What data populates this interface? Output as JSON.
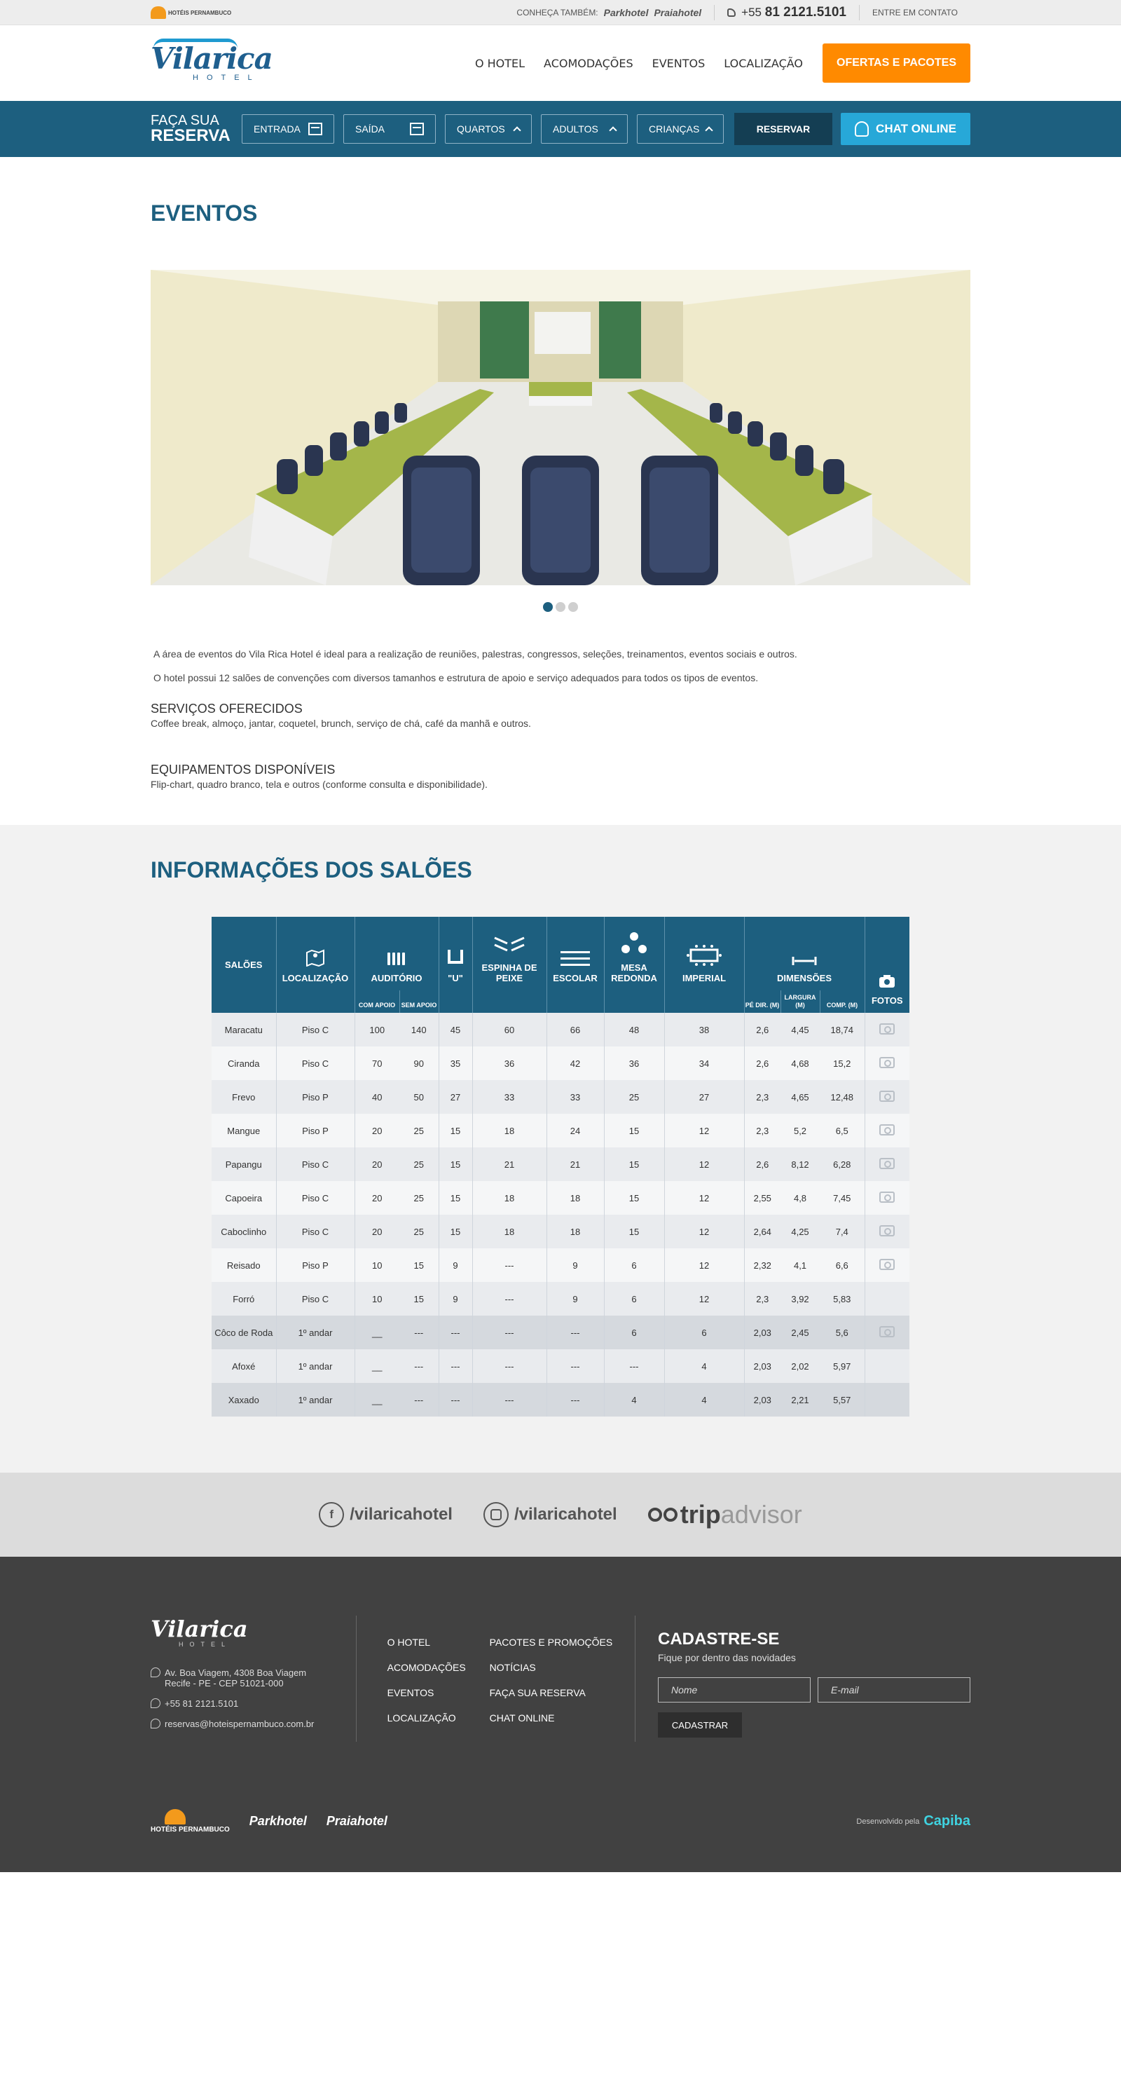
{
  "topbar": {
    "logo_label": "HOTÉIS PERNAMBUCO",
    "conheca": "CONHEÇA TAMBÉM:",
    "brand1": "Parkhotel",
    "brand2": "Praiahotel",
    "phone_prefix": "+55",
    "phone_number": "81 2121.5101",
    "contact": "ENTRE EM CONTATO"
  },
  "header": {
    "logo_main": "Vilarica",
    "logo_sub": "HOTEL",
    "nav": [
      "O HOTEL",
      "ACOMODAÇÕES",
      "EVENTOS",
      "LOCALIZAÇÃO"
    ],
    "cta": "OFERTAS E PACOTES"
  },
  "booking": {
    "title1": "FAÇA SUA",
    "title2": "RESERVA",
    "entrada": "ENTRADA",
    "saida": "SAÍDA",
    "quartos": "QUARTOS",
    "adultos": "ADULTOS",
    "criancas": "CRIANÇAS",
    "reservar": "RESERVAR",
    "chat": "CHAT ONLINE"
  },
  "eventos": {
    "title": "EVENTOS",
    "intro1": "A área de eventos do Vila Rica Hotel é ideal para a realização de reuniões, palestras, congressos, seleções, treinamentos, eventos sociais e outros.",
    "intro2": "O hotel possui 12 salões de convenções com diversos tamanhos e estrutura de apoio e serviço adequados para todos os tipos de eventos.",
    "servicos_h": "SERVIÇOS OFERECIDOS",
    "servicos_p": "Coffee break, almoço, jantar, coquetel, brunch, serviço de chá, café da manhã e outros.",
    "equip_h": "EQUIPAMENTOS DISPONÍVEIS",
    "equip_p": "Flip-chart, quadro branco, tela e outros (conforme consulta e disponibilidade)."
  },
  "saloes": {
    "title": "INFORMAÇÕES DOS SALÕES",
    "headers": {
      "saloes": "SALÕES",
      "localizacao": "LOCALIZAÇÃO",
      "auditorio": "AUDITÓRIO",
      "u": "\"U\"",
      "espinha": "ESPINHA DE PEIXE",
      "escolar": "ESCOLAR",
      "mesa": "MESA REDONDA",
      "imperial": "IMPERIAL",
      "dimensoes": "DIMENSÕES",
      "fotos": "FOTOS",
      "com_apoio": "COM APOIO",
      "sem_apoio": "SEM APOIO",
      "pe_dir": "PÉ DIR. (M)",
      "largura": "LARGURA (M)",
      "comp": "COMP. (M)"
    },
    "rows": [
      {
        "nome": "Maracatu",
        "loc": "Piso C",
        "com": "100",
        "sem": "140",
        "u": "45",
        "esp": "60",
        "esc": "66",
        "mesa": "48",
        "imp": "38",
        "pe": "2,6",
        "larg": "4,45",
        "comp": "18,74",
        "foto": true
      },
      {
        "nome": "Ciranda",
        "loc": "Piso C",
        "com": "70",
        "sem": "90",
        "u": "35",
        "esp": "36",
        "esc": "42",
        "mesa": "36",
        "imp": "34",
        "pe": "2,6",
        "larg": "4,68",
        "comp": "15,2",
        "foto": true
      },
      {
        "nome": "Frevo",
        "loc": "Piso P",
        "com": "40",
        "sem": "50",
        "u": "27",
        "esp": "33",
        "esc": "33",
        "mesa": "25",
        "imp": "27",
        "pe": "2,3",
        "larg": "4,65",
        "comp": "12,48",
        "foto": true
      },
      {
        "nome": "Mangue",
        "loc": "Piso P",
        "com": "20",
        "sem": "25",
        "u": "15",
        "esp": "18",
        "esc": "24",
        "mesa": "15",
        "imp": "12",
        "pe": "2,3",
        "larg": "5,2",
        "comp": "6,5",
        "foto": true
      },
      {
        "nome": "Papangu",
        "loc": "Piso C",
        "com": "20",
        "sem": "25",
        "u": "15",
        "esp": "21",
        "esc": "21",
        "mesa": "15",
        "imp": "12",
        "pe": "2,6",
        "larg": "8,12",
        "comp": "6,28",
        "foto": true
      },
      {
        "nome": "Capoeira",
        "loc": "Piso C",
        "com": "20",
        "sem": "25",
        "u": "15",
        "esp": "18",
        "esc": "18",
        "mesa": "15",
        "imp": "12",
        "pe": "2,55",
        "larg": "4,8",
        "comp": "7,45",
        "foto": true
      },
      {
        "nome": "Caboclinho",
        "loc": "Piso C",
        "com": "20",
        "sem": "25",
        "u": "15",
        "esp": "18",
        "esc": "18",
        "mesa": "15",
        "imp": "12",
        "pe": "2,64",
        "larg": "4,25",
        "comp": "7,4",
        "foto": true
      },
      {
        "nome": "Reisado",
        "loc": "Piso P",
        "com": "10",
        "sem": "15",
        "u": "9",
        "esp": "---",
        "esc": "9",
        "mesa": "6",
        "imp": "12",
        "pe": "2,32",
        "larg": "4,1",
        "comp": "6,6",
        "foto": true
      },
      {
        "nome": "Forró",
        "loc": "Piso C",
        "com": "10",
        "sem": "15",
        "u": "9",
        "esp": "---",
        "esc": "9",
        "mesa": "6",
        "imp": "12",
        "pe": "2,3",
        "larg": "3,92",
        "comp": "5,83",
        "foto": false
      },
      {
        "nome": "Côco de Roda",
        "loc": "1º andar",
        "com": "__",
        "sem": "---",
        "u": "---",
        "esp": "---",
        "esc": "---",
        "mesa": "6",
        "imp": "6",
        "pe": "2,03",
        "larg": "2,45",
        "comp": "5,6",
        "foto": true
      },
      {
        "nome": "Afoxé",
        "loc": "1º andar",
        "com": "__",
        "sem": "---",
        "u": "---",
        "esp": "---",
        "esc": "---",
        "mesa": "---",
        "imp": "4",
        "pe": "2,03",
        "larg": "2,02",
        "comp": "5,97",
        "foto": false
      },
      {
        "nome": "Xaxado",
        "loc": "1º andar",
        "com": "__",
        "sem": "---",
        "u": "---",
        "esp": "---",
        "esc": "---",
        "mesa": "4",
        "imp": "4",
        "pe": "2,03",
        "larg": "2,21",
        "comp": "5,57",
        "foto": false
      }
    ]
  },
  "social": {
    "facebook": "/vilaricahotel",
    "instagram": "/vilaricahotel",
    "trip": "trip",
    "advisor": "advisor"
  },
  "footer": {
    "logo": "Vilarica",
    "logo_sub": "HOTEL",
    "address1": "Av. Boa Viagem, 4308 Boa Viagem",
    "address2": "Recife - PE - CEP 51021-000",
    "phone": "+55 81 2121.5101",
    "email": "reservas@hoteispernambuco.com.br",
    "links_col1": [
      "O HOTEL",
      "ACOMODAÇÕES",
      "EVENTOS",
      "LOCALIZAÇÃO"
    ],
    "links_col2": [
      "PACOTES E PROMOÇÕES",
      "NOTÍCIAS",
      "FAÇA SUA RESERVA",
      "CHAT ONLINE"
    ],
    "cad_title": "CADASTRE-SE",
    "cad_sub": "Fique por dentro das novidades",
    "nome_ph": "Nome",
    "email_ph": "E-mail",
    "cadastrar": "CADASTRAR",
    "logo_hp": "HOTÉIS PERNAMBUCO",
    "logo_park": "Parkhotel",
    "logo_praia": "Praiahotel",
    "dev_label": "Desenvolvido pela",
    "dev_brand": "Capiba"
  },
  "colors": {
    "primary": "#1d5f7f",
    "cta": "#ff8a00",
    "chat": "#27a8d8",
    "footer": "#414141"
  }
}
